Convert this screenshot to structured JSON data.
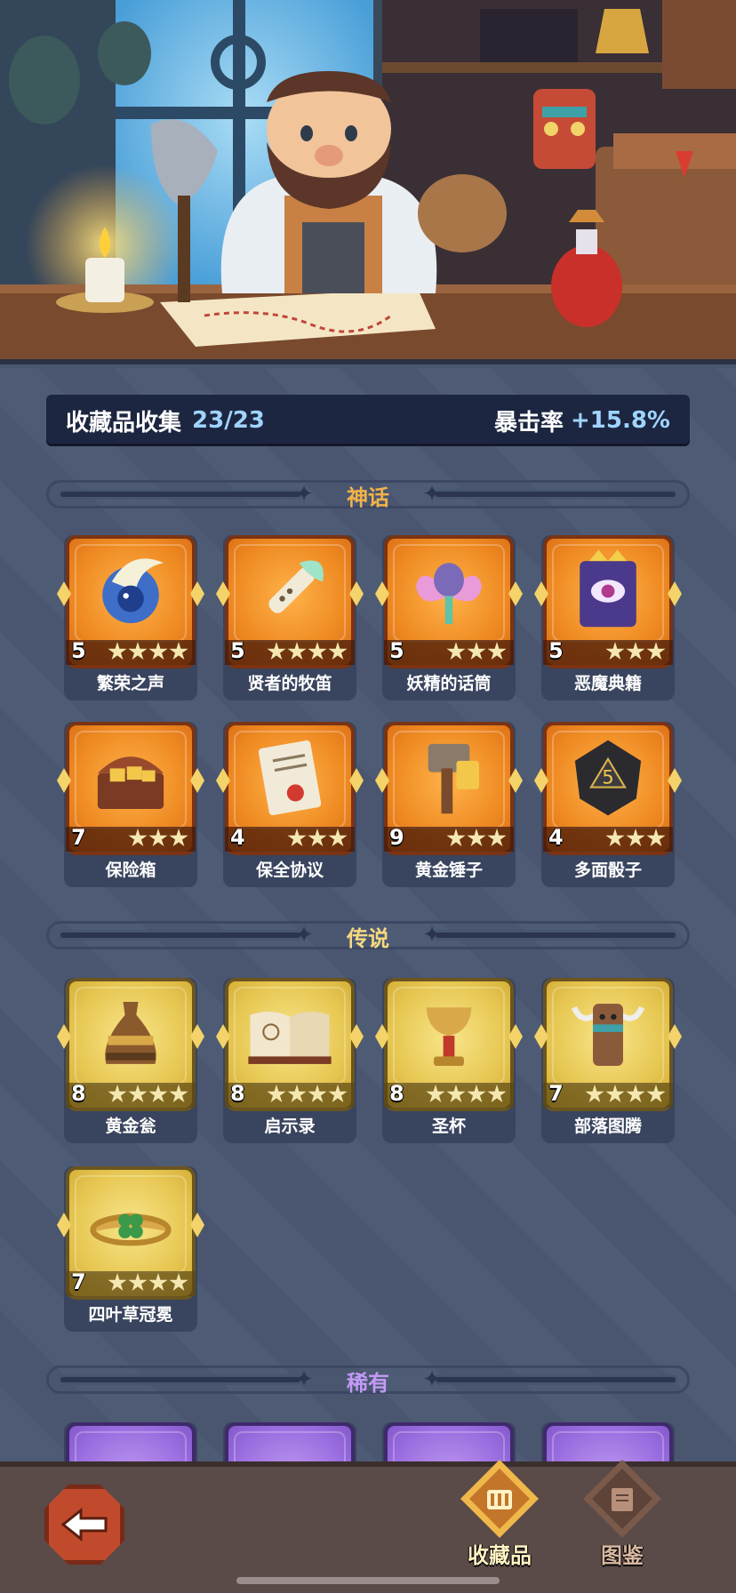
{
  "summary": {
    "label": "收藏品收集",
    "count": "23/23",
    "stat_label": "暴击率",
    "stat_value": "+15.8%"
  },
  "sections": {
    "mythic": {
      "title": "神话",
      "color": "#f2b24a"
    },
    "legend": {
      "title": "传说",
      "color": "#f5d980"
    },
    "rare": {
      "title": "稀有",
      "color": "#c29af5"
    }
  },
  "mythic_items": [
    {
      "name": "繁荣之声",
      "level": "5",
      "stars": 4,
      "icon": "prosperity-voice-icon"
    },
    {
      "name": "贤者的牧笛",
      "level": "5",
      "stars": 4,
      "icon": "sage-flute-icon"
    },
    {
      "name": "妖精的话筒",
      "level": "5",
      "stars": 3,
      "icon": "fairy-microphone-icon"
    },
    {
      "name": "恶魔典籍",
      "level": "5",
      "stars": 3,
      "icon": "demon-tome-icon"
    },
    {
      "name": "保险箱",
      "level": "7",
      "stars": 3,
      "icon": "treasure-chest-icon"
    },
    {
      "name": "保全协议",
      "level": "4",
      "stars": 3,
      "icon": "agreement-scroll-icon"
    },
    {
      "name": "黄金锤子",
      "level": "9",
      "stars": 3,
      "icon": "golden-hammer-icon"
    },
    {
      "name": "多面骰子",
      "level": "4",
      "stars": 3,
      "icon": "polyhedral-dice-icon"
    }
  ],
  "legend_items": [
    {
      "name": "黄金瓮",
      "level": "8",
      "stars": 4,
      "icon": "golden-urn-icon"
    },
    {
      "name": "启示录",
      "level": "8",
      "stars": 4,
      "icon": "open-book-icon"
    },
    {
      "name": "圣杯",
      "level": "8",
      "stars": 4,
      "icon": "holy-grail-icon"
    },
    {
      "name": "部落图腾",
      "level": "7",
      "stars": 4,
      "icon": "tribal-totem-icon"
    },
    {
      "name": "四叶草冠冕",
      "level": "7",
      "stars": 4,
      "icon": "clover-crown-icon"
    }
  ],
  "tabs": {
    "collection": "收藏品",
    "codex": "图鉴"
  }
}
